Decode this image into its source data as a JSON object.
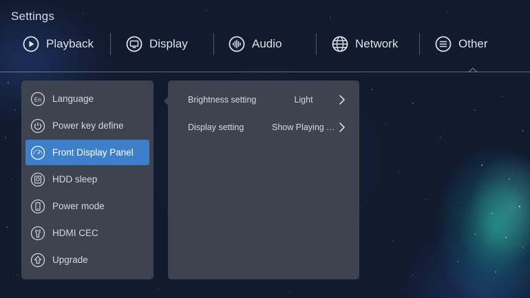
{
  "title": "Settings",
  "tabs": [
    {
      "label": "Playback",
      "icon": "play-icon"
    },
    {
      "label": "Display",
      "icon": "monitor-icon"
    },
    {
      "label": "Audio",
      "icon": "audio-icon"
    },
    {
      "label": "Network",
      "icon": "globe-icon"
    },
    {
      "label": "Other",
      "icon": "menu-list-icon"
    }
  ],
  "active_tab": "Other",
  "menu": {
    "items": [
      {
        "label": "Language",
        "icon": "language-icon"
      },
      {
        "label": "Power key define",
        "icon": "power-icon"
      },
      {
        "label": "Front Display Panel",
        "icon": "gauge-icon"
      },
      {
        "label": "HDD sleep",
        "icon": "hdd-icon"
      },
      {
        "label": "Power mode",
        "icon": "phone-icon"
      },
      {
        "label": "HDMI CEC",
        "icon": "hdmi-icon"
      },
      {
        "label": "Upgrade",
        "icon": "upgrade-icon"
      }
    ],
    "selected": "Front Display Panel"
  },
  "submenu": {
    "rows": [
      {
        "label": "Brightness setting",
        "value": "Light"
      },
      {
        "label": "Display setting",
        "value": "Show Playing Ti..."
      }
    ]
  },
  "colors": {
    "selected_bg": "#3d80c9",
    "panel_bg": "#42465a",
    "text": "#d4d8df"
  }
}
